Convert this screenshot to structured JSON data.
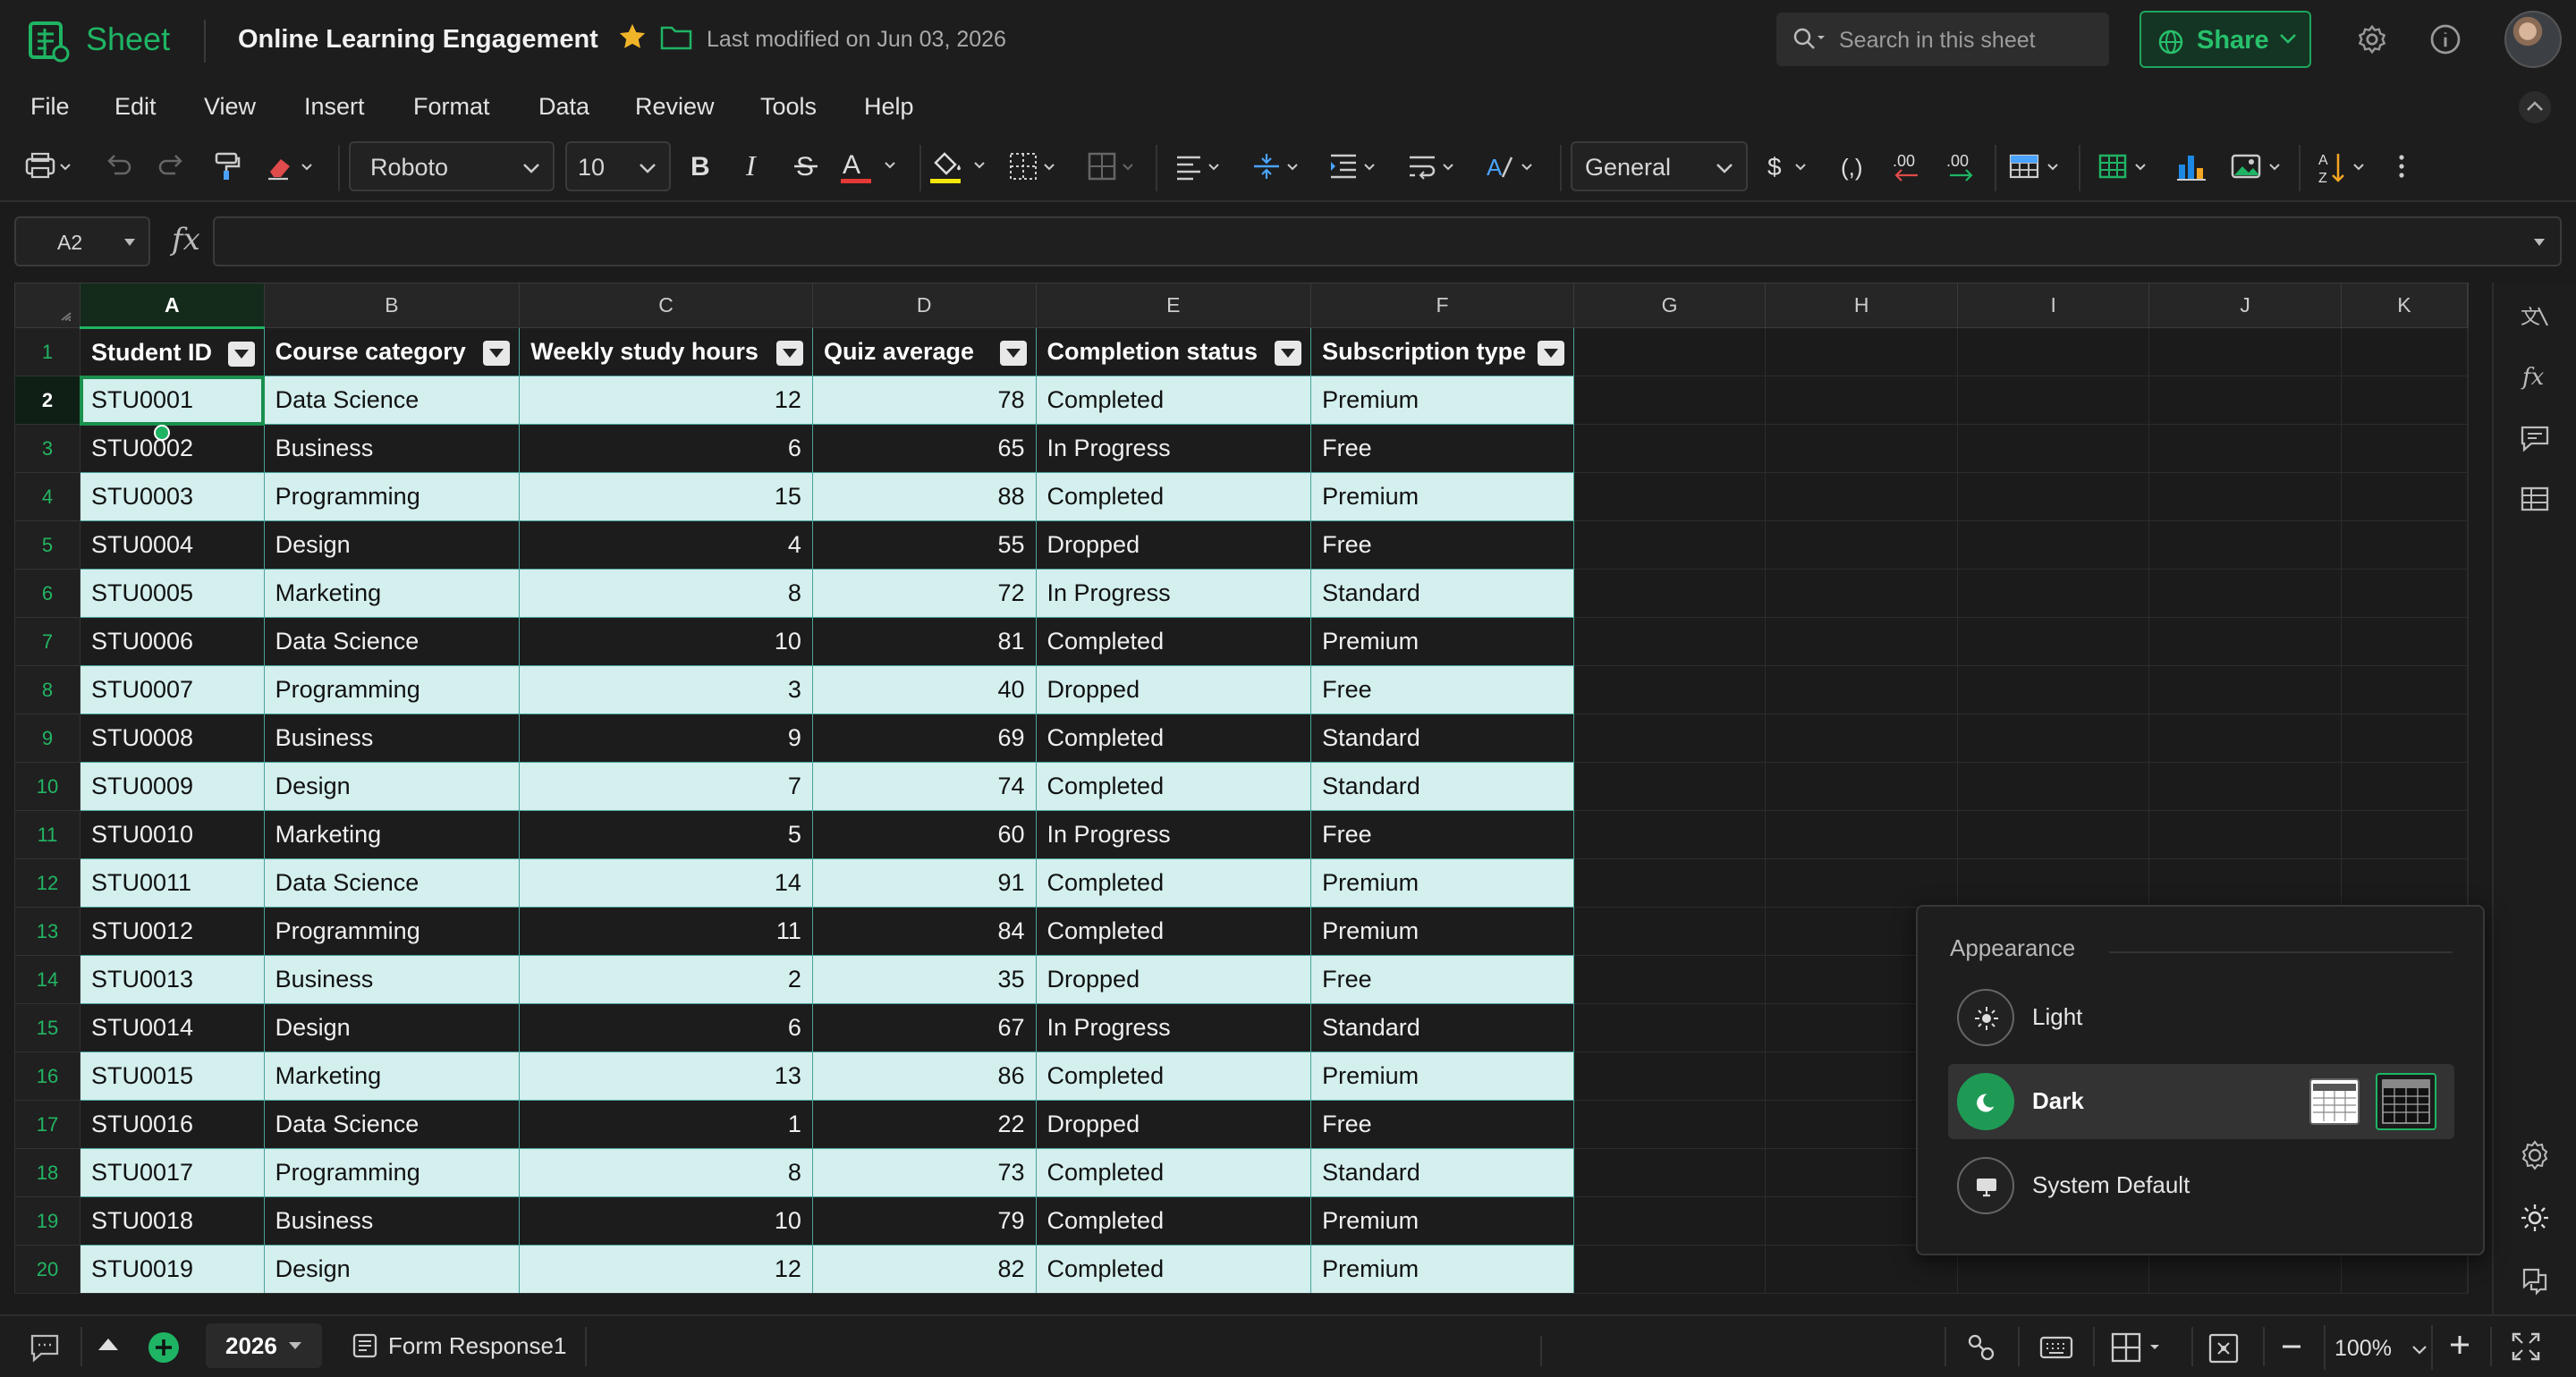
{
  "app": {
    "name": "Sheet",
    "doc_title": "Online Learning Engagement",
    "last_modified": "Last modified on Jun 03, 2026"
  },
  "search": {
    "placeholder": "Search in this sheet"
  },
  "share": {
    "label": "Share"
  },
  "menu": [
    "File",
    "Edit",
    "View",
    "Insert",
    "Format",
    "Data",
    "Review",
    "Tools",
    "Help"
  ],
  "toolbar": {
    "font_name": "Roboto",
    "font_size": "10",
    "number_format": "General"
  },
  "formula_bar": {
    "cell_ref": "A2",
    "fx": "fx",
    "formula": ""
  },
  "grid": {
    "columns": [
      "A",
      "B",
      "C",
      "D",
      "E",
      "F",
      "G",
      "H",
      "I",
      "J",
      "K"
    ],
    "selected_column": "A",
    "selected_row": "2",
    "headers": [
      "Student ID",
      "Course category",
      "Weekly study hours",
      "Quiz average",
      "Completion status",
      "Subscription type"
    ],
    "rows": [
      [
        "STU0001",
        "Data Science",
        "12",
        "78",
        "Completed",
        "Premium"
      ],
      [
        "STU0002",
        "Business",
        "6",
        "65",
        "In Progress",
        "Free"
      ],
      [
        "STU0003",
        "Programming",
        "15",
        "88",
        "Completed",
        "Premium"
      ],
      [
        "STU0004",
        "Design",
        "4",
        "55",
        "Dropped",
        "Free"
      ],
      [
        "STU0005",
        "Marketing",
        "8",
        "72",
        "In Progress",
        "Standard"
      ],
      [
        "STU0006",
        "Data Science",
        "10",
        "81",
        "Completed",
        "Premium"
      ],
      [
        "STU0007",
        "Programming",
        "3",
        "40",
        "Dropped",
        "Free"
      ],
      [
        "STU0008",
        "Business",
        "9",
        "69",
        "Completed",
        "Standard"
      ],
      [
        "STU0009",
        "Design",
        "7",
        "74",
        "Completed",
        "Standard"
      ],
      [
        "STU0010",
        "Marketing",
        "5",
        "60",
        "In Progress",
        "Free"
      ],
      [
        "STU0011",
        "Data Science",
        "14",
        "91",
        "Completed",
        "Premium"
      ],
      [
        "STU0012",
        "Programming",
        "11",
        "84",
        "Completed",
        "Premium"
      ],
      [
        "STU0013",
        "Business",
        "2",
        "35",
        "Dropped",
        "Free"
      ],
      [
        "STU0014",
        "Design",
        "6",
        "67",
        "In Progress",
        "Standard"
      ],
      [
        "STU0015",
        "Marketing",
        "13",
        "86",
        "Completed",
        "Premium"
      ],
      [
        "STU0016",
        "Data Science",
        "1",
        "22",
        "Dropped",
        "Free"
      ],
      [
        "STU0017",
        "Programming",
        "8",
        "73",
        "Completed",
        "Standard"
      ],
      [
        "STU0018",
        "Business",
        "10",
        "79",
        "Completed",
        "Premium"
      ],
      [
        "STU0019",
        "Design",
        "12",
        "82",
        "Completed",
        "Premium"
      ]
    ]
  },
  "appearance": {
    "title": "Appearance",
    "options": [
      {
        "label": "Light",
        "icon": "sun-icon"
      },
      {
        "label": "Dark",
        "icon": "moon-icon",
        "selected": true
      },
      {
        "label": "System Default",
        "icon": "monitor-icon"
      }
    ]
  },
  "sheets": [
    {
      "label": "2026",
      "active": true
    },
    {
      "label": "Form Response1",
      "active": false
    }
  ],
  "zoom": "100%",
  "colors": {
    "accent": "#1fb464",
    "band_light": "#d3efee",
    "band_dark": "#1c1c1c",
    "table_border": "#4aa39a"
  }
}
